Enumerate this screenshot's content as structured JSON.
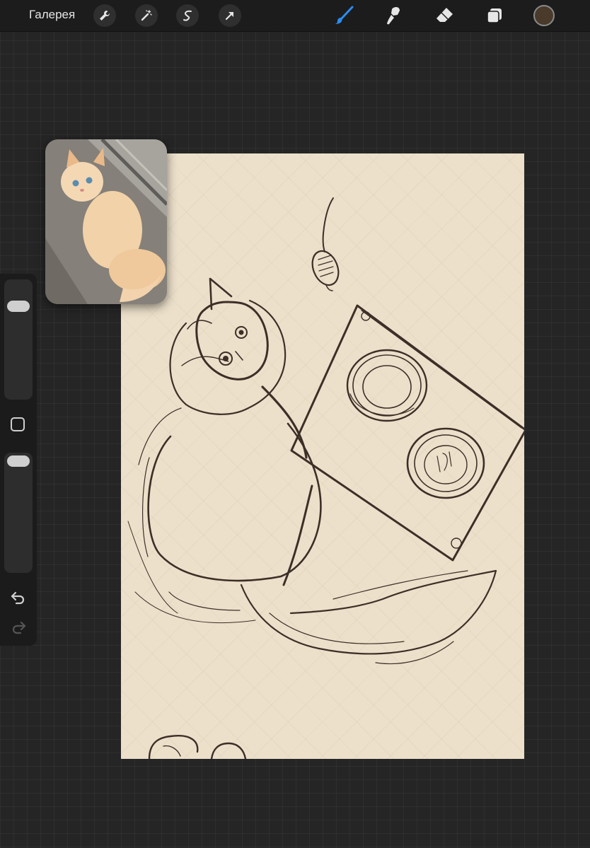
{
  "app": {
    "gallery_label": "Галерея"
  },
  "toolbar": {
    "left_icons": [
      "wrench-icon",
      "magic-wand-icon",
      "selection-icon",
      "transform-arrow-icon"
    ],
    "right_icons": [
      "brush-icon",
      "smudge-icon",
      "eraser-icon",
      "layers-icon"
    ],
    "active_tool": "brush",
    "active_color": "#4a3a2b",
    "accent_color": "#2a8cf2"
  },
  "sidebar": {
    "brush_size_level": 0.05,
    "opacity_level": 0.05,
    "icons": [
      "modify-square-icon",
      "undo-icon",
      "redo-icon"
    ]
  },
  "reference": {
    "subject": "cat-photo"
  },
  "canvas": {
    "background_color": "#ece0ca",
    "ink_color": "#3c2f28"
  }
}
